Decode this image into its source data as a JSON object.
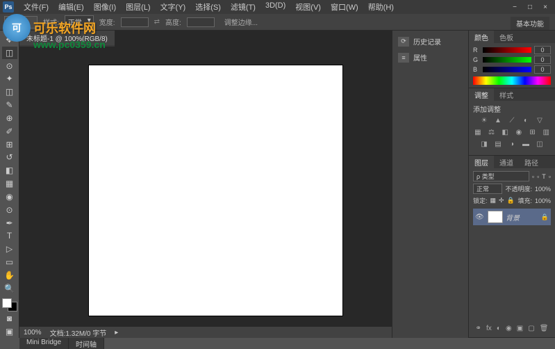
{
  "title_menu": {
    "items": [
      "文件(F)",
      "编辑(E)",
      "图像(I)",
      "图层(L)",
      "文字(Y)",
      "选择(S)",
      "滤镜(T)",
      "3D(D)",
      "视图(V)",
      "窗口(W)",
      "帮助(H)"
    ]
  },
  "window_controls": {
    "min": "−",
    "max": "□",
    "close": "×"
  },
  "options_bar": {
    "mode_label": "样式:",
    "mode_value": "正常",
    "width_label": "宽度:",
    "height_label": "高度:",
    "adjust_btn": "调整边缘..."
  },
  "top_right_label": "基本功能",
  "doc_tab": "未标题-1 @ 100%(RGB/8)",
  "zoom": {
    "percent": "100%",
    "info": "文档:1.32M/0 字节"
  },
  "bottom_tabs": [
    "Mini Bridge",
    "时间轴"
  ],
  "mid_panels": {
    "history": "历史记录",
    "properties": "属性"
  },
  "color_panel": {
    "tab1": "颜色",
    "tab2": "色板",
    "r": {
      "label": "R",
      "value": "0"
    },
    "g": {
      "label": "G",
      "value": "0"
    },
    "b": {
      "label": "B",
      "value": "0"
    }
  },
  "adjust_panel": {
    "tab1": "调整",
    "tab2": "样式",
    "title": "添加调整"
  },
  "layers_panel": {
    "tab1": "图层",
    "tab2": "通道",
    "tab3": "路径",
    "kind_label": "ρ 类型",
    "blend": "正常",
    "opacity_label": "不透明度:",
    "opacity": "100%",
    "lock_label": "锁定:",
    "fill_label": "填充:",
    "fill": "100%",
    "bg_layer": "背景"
  },
  "watermark": {
    "brand": "可乐软件网",
    "url": "www.pc0359.cn"
  }
}
